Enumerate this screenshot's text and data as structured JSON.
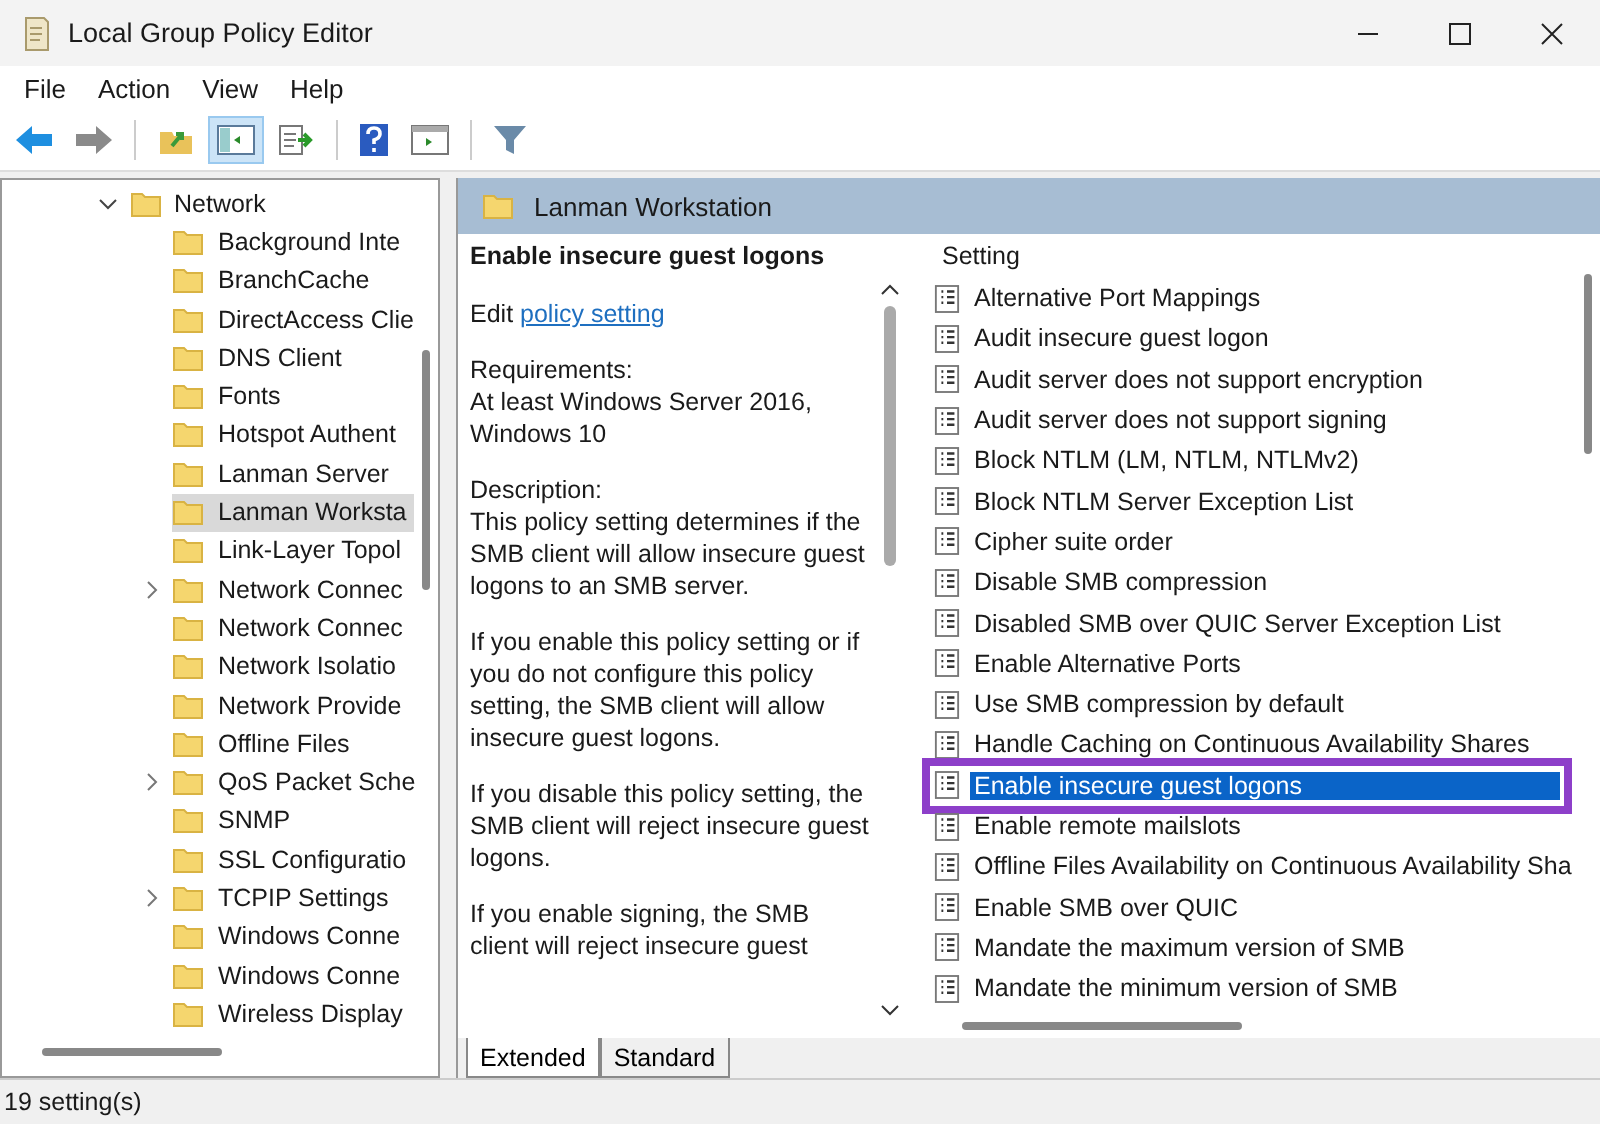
{
  "window": {
    "title": "Local Group Policy Editor"
  },
  "menu": [
    "File",
    "Action",
    "View",
    "Help"
  ],
  "toolbar": [
    {
      "kind": "back",
      "pressed": false
    },
    {
      "kind": "forward",
      "pressed": false
    },
    {
      "kind": "up",
      "pressed": false
    },
    {
      "kind": "tree",
      "pressed": true
    },
    {
      "kind": "export",
      "pressed": false
    },
    {
      "kind": "help",
      "pressed": false
    },
    {
      "kind": "pane",
      "pressed": false
    },
    {
      "kind": "filter",
      "pressed": false
    }
  ],
  "tree": {
    "label": "Network",
    "expanded": true,
    "children": [
      {
        "label": "Background Inte",
        "has_children": false,
        "selected": false
      },
      {
        "label": "BranchCache",
        "has_children": false,
        "selected": false
      },
      {
        "label": "DirectAccess Clie",
        "has_children": false,
        "selected": false
      },
      {
        "label": "DNS Client",
        "has_children": false,
        "selected": false
      },
      {
        "label": "Fonts",
        "has_children": false,
        "selected": false
      },
      {
        "label": "Hotspot Authent",
        "has_children": false,
        "selected": false
      },
      {
        "label": "Lanman Server",
        "has_children": false,
        "selected": false
      },
      {
        "label": "Lanman Worksta",
        "has_children": false,
        "selected": true
      },
      {
        "label": "Link-Layer Topol",
        "has_children": false,
        "selected": false
      },
      {
        "label": "Network Connec",
        "has_children": true,
        "selected": false
      },
      {
        "label": "Network Connec",
        "has_children": false,
        "selected": false
      },
      {
        "label": "Network Isolatio",
        "has_children": false,
        "selected": false
      },
      {
        "label": "Network Provide",
        "has_children": false,
        "selected": false
      },
      {
        "label": "Offline Files",
        "has_children": false,
        "selected": false
      },
      {
        "label": "QoS Packet Sche",
        "has_children": true,
        "selected": false
      },
      {
        "label": "SNMP",
        "has_children": false,
        "selected": false
      },
      {
        "label": "SSL Configuratio",
        "has_children": false,
        "selected": false
      },
      {
        "label": "TCPIP Settings",
        "has_children": true,
        "selected": false
      },
      {
        "label": "Windows Conne",
        "has_children": false,
        "selected": false
      },
      {
        "label": "Windows Conne",
        "has_children": false,
        "selected": false
      },
      {
        "label": "Wireless Display",
        "has_children": false,
        "selected": false
      }
    ]
  },
  "panel_header": "Lanman Workstation",
  "description": {
    "title": "Enable insecure guest logons",
    "edit_prefix": "Edit",
    "edit_link": "policy setting",
    "paragraphs": [
      "Requirements:\nAt least Windows Server 2016, Windows 10",
      "Description:\nThis policy setting determines if the SMB client will allow insecure guest logons to an SMB server.",
      "If you enable this policy setting or if you do not configure this policy setting, the SMB client will allow insecure guest logons.",
      "If you disable this policy setting, the SMB client will reject insecure guest logons.",
      "If you enable signing, the SMB client will reject insecure guest"
    ]
  },
  "list": {
    "column": "Setting",
    "rows": [
      {
        "name": "Alternative Port Mappings",
        "selected": false
      },
      {
        "name": "Audit insecure guest logon",
        "selected": false
      },
      {
        "name": "Audit server does not support encryption",
        "selected": false
      },
      {
        "name": "Audit server does not support signing",
        "selected": false
      },
      {
        "name": "Block NTLM (LM, NTLM, NTLMv2)",
        "selected": false
      },
      {
        "name": "Block NTLM Server Exception List",
        "selected": false
      },
      {
        "name": "Cipher suite order",
        "selected": false
      },
      {
        "name": "Disable SMB compression",
        "selected": false
      },
      {
        "name": "Disabled SMB over QUIC Server Exception List",
        "selected": false
      },
      {
        "name": "Enable Alternative Ports",
        "selected": false
      },
      {
        "name": "Use SMB compression by default",
        "selected": false
      },
      {
        "name": "Handle Caching on Continuous Availability Shares",
        "selected": false
      },
      {
        "name": "Enable insecure guest logons",
        "selected": true
      },
      {
        "name": "Enable remote mailslots",
        "selected": false
      },
      {
        "name": "Offline Files Availability on Continuous Availability Sha",
        "selected": false
      },
      {
        "name": "Enable SMB over QUIC",
        "selected": false
      },
      {
        "name": "Mandate the maximum version of SMB",
        "selected": false
      },
      {
        "name": "Mandate the minimum version of SMB",
        "selected": false
      }
    ]
  },
  "tabs": [
    {
      "label": "Extended",
      "selected": true
    },
    {
      "label": "Standard",
      "selected": false
    }
  ],
  "status_bar": "19 setting(s)"
}
